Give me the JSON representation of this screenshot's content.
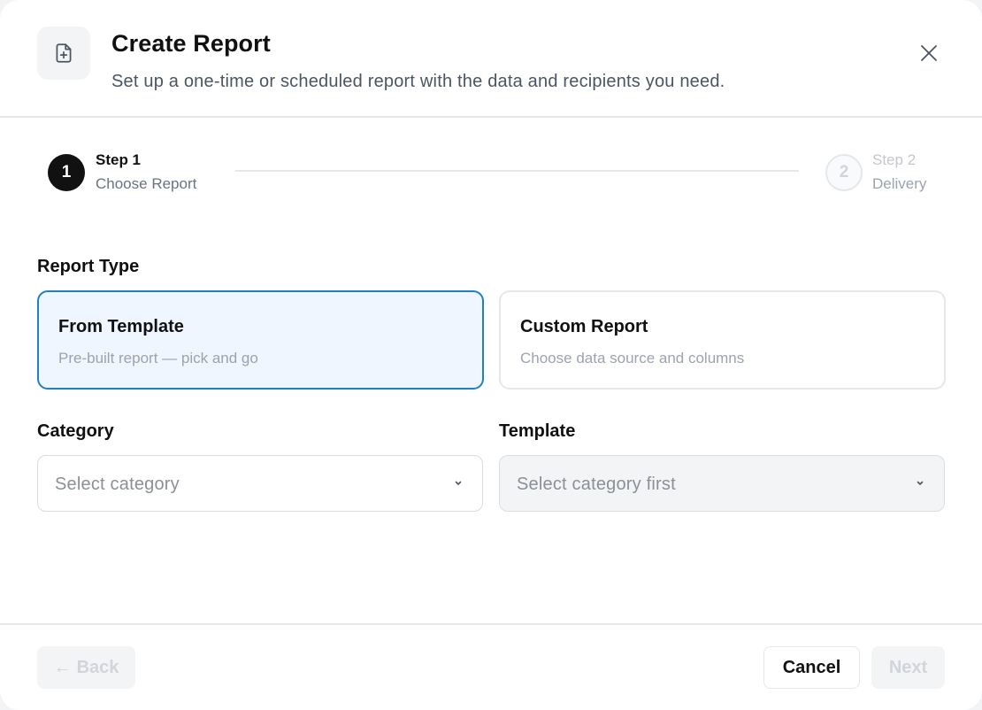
{
  "dialog": {
    "icon": "file-plus-icon",
    "title": "Create Report",
    "subtitle": "Set up a one-time or scheduled report with the data and recipients you need.",
    "close_icon": "close-icon"
  },
  "stepper": {
    "steps": [
      {
        "number": "1",
        "title": "Step 1",
        "subtitle": "Choose Report",
        "state": "active"
      },
      {
        "number": "2",
        "title": "Step 2",
        "subtitle": "Delivery",
        "state": "upcoming"
      }
    ]
  },
  "report_type": {
    "label": "Report Type",
    "options": [
      {
        "title": "From Template",
        "description": "Pre-built report — pick and go",
        "selected": true
      },
      {
        "title": "Custom Report",
        "description": "Choose data source and columns",
        "selected": false
      }
    ]
  },
  "category": {
    "label": "Category",
    "placeholder": "Select category"
  },
  "template": {
    "label": "Template",
    "placeholder": "Select category first",
    "disabled": true
  },
  "footer": {
    "back_label": "Back",
    "back_arrow": "←",
    "cancel_label": "Cancel",
    "next_label": "Next"
  },
  "colors": {
    "accent": "#1e82c0",
    "selected_bg": "#eff6ff",
    "primary": "#111111"
  }
}
